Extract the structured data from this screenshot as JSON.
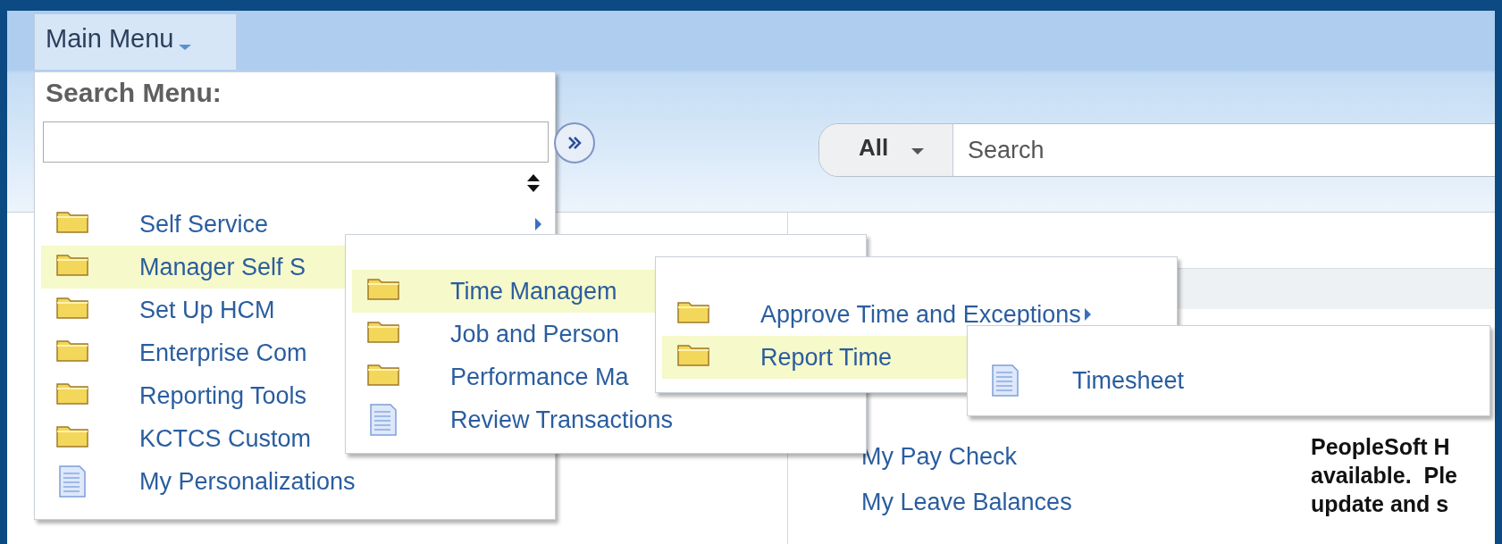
{
  "main_menu": {
    "label": "Main Menu"
  },
  "search_menu": {
    "title": "Search Menu:"
  },
  "menus": [
    {
      "items": [
        {
          "label": "Self Service",
          "kind": "folder",
          "selected": false,
          "submenu_arrow": true
        },
        {
          "label": "Manager Self S",
          "kind": "folder",
          "selected": true,
          "submenu_arrow": false
        },
        {
          "label": "Set Up HCM",
          "kind": "folder",
          "selected": false,
          "submenu_arrow": false
        },
        {
          "label": "Enterprise Com",
          "kind": "folder",
          "selected": false,
          "submenu_arrow": false
        },
        {
          "label": "Reporting Tools",
          "kind": "folder",
          "selected": false,
          "submenu_arrow": false
        },
        {
          "label": "KCTCS Custom",
          "kind": "folder",
          "selected": false,
          "submenu_arrow": false
        },
        {
          "label": "My Personalizations",
          "kind": "page",
          "selected": false,
          "submenu_arrow": false
        }
      ]
    },
    {
      "items": [
        {
          "label": "Time Managem",
          "kind": "folder",
          "selected": true,
          "submenu_arrow": false
        },
        {
          "label": "Job and Person",
          "kind": "folder",
          "selected": false,
          "submenu_arrow": false
        },
        {
          "label": "Performance Ma",
          "kind": "folder",
          "selected": false,
          "submenu_arrow": false
        },
        {
          "label": "Review Transactions",
          "kind": "page",
          "selected": false,
          "submenu_arrow": false
        }
      ]
    },
    {
      "items": [
        {
          "label": "Approve Time and Exceptions",
          "kind": "folder",
          "selected": false,
          "submenu_arrow": true
        },
        {
          "label": "Report Time",
          "kind": "folder",
          "selected": true,
          "submenu_arrow": false
        }
      ]
    },
    {
      "items": [
        {
          "label": "Timesheet",
          "kind": "page",
          "selected": false,
          "submenu_arrow": false
        }
      ]
    }
  ],
  "search": {
    "scope": "All",
    "placeholder": "Search"
  },
  "links": [
    "My Pay Check",
    "My Leave Balances"
  ],
  "notice": [
    "PeopleSoft H",
    "available.  Ple",
    "update and s"
  ]
}
